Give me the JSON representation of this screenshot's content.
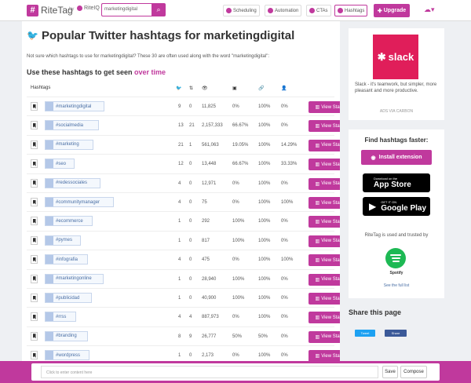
{
  "brand": {
    "logo_text": "RiteTag",
    "by": "by",
    "riteq": "RiteIQ",
    "accent": "#c0399d"
  },
  "search": {
    "value": "marketingdigital"
  },
  "nav": [
    {
      "label": "Scheduling",
      "active": false
    },
    {
      "label": "Automation",
      "active": false
    },
    {
      "label": "CTAs",
      "active": false
    },
    {
      "label": "Hashtags",
      "active": true
    }
  ],
  "upgrade_label": "Upgrade",
  "page": {
    "title": "Popular Twitter hashtags for marketingdigital",
    "description": "Not sure which hashtags to use for marketingdigital? These 30 are often used along with the word \"marketingdigital\":",
    "subtitle": "Use these hashtags to get seen ",
    "subtitle_accent": "over time"
  },
  "table": {
    "header_label": "Hashtags",
    "view_stats_label": "View Stats",
    "rows": [
      {
        "tag": "#marketingdigital",
        "tweets": "9",
        "retweets": "0",
        "exposure": "11,825",
        "images": "0%",
        "links": "100%",
        "mentions": "0%"
      },
      {
        "tag": "#socialmedia",
        "tweets": "13",
        "retweets": "21",
        "exposure": "2,157,333",
        "images": "66.67%",
        "links": "100%",
        "mentions": "0%"
      },
      {
        "tag": "#marketing",
        "tweets": "21",
        "retweets": "1",
        "exposure": "561,063",
        "images": "19.05%",
        "links": "100%",
        "mentions": "14.29%"
      },
      {
        "tag": "#seo",
        "tweets": "12",
        "retweets": "0",
        "exposure": "13,448",
        "images": "66.67%",
        "links": "100%",
        "mentions": "33.33%"
      },
      {
        "tag": "#redessociales",
        "tweets": "4",
        "retweets": "0",
        "exposure": "12,971",
        "images": "0%",
        "links": "100%",
        "mentions": "0%"
      },
      {
        "tag": "#communitymanager",
        "tweets": "4",
        "retweets": "0",
        "exposure": "75",
        "images": "0%",
        "links": "100%",
        "mentions": "100%"
      },
      {
        "tag": "#ecommerce",
        "tweets": "1",
        "retweets": "0",
        "exposure": "292",
        "images": "100%",
        "links": "100%",
        "mentions": "0%"
      },
      {
        "tag": "#pymes",
        "tweets": "1",
        "retweets": "0",
        "exposure": "817",
        "images": "100%",
        "links": "100%",
        "mentions": "0%"
      },
      {
        "tag": "#infografia",
        "tweets": "4",
        "retweets": "0",
        "exposure": "475",
        "images": "0%",
        "links": "100%",
        "mentions": "100%"
      },
      {
        "tag": "#marketingonline",
        "tweets": "1",
        "retweets": "0",
        "exposure": "28,940",
        "images": "100%",
        "links": "100%",
        "mentions": "0%"
      },
      {
        "tag": "#publicidad",
        "tweets": "1",
        "retweets": "0",
        "exposure": "40,900",
        "images": "100%",
        "links": "100%",
        "mentions": "0%"
      },
      {
        "tag": "#rrss",
        "tweets": "4",
        "retweets": "4",
        "exposure": "887,973",
        "images": "0%",
        "links": "100%",
        "mentions": "0%"
      },
      {
        "tag": "#branding",
        "tweets": "8",
        "retweets": "9",
        "exposure": "26,777",
        "images": "50%",
        "links": "50%",
        "mentions": "0%"
      },
      {
        "tag": "#wordpress",
        "tweets": "1",
        "retweets": "0",
        "exposure": "2,173",
        "images": "0%",
        "links": "100%",
        "mentions": "0%"
      }
    ]
  },
  "ad": {
    "logo_text": "slack",
    "text": "Slack - it's teamwork, but simpler, more pleasant and more productive.",
    "ads_by": "ADS VIA CARBON"
  },
  "sidebar": {
    "find_title": "Find hashtags faster:",
    "install_label": "Install extension",
    "appstore_small": "Download on the",
    "appstore_big": "App Store",
    "gplay_small": "GET IT ON",
    "gplay_big": "Google Play",
    "trusted": "RiteTag is used and trusted by",
    "spotify": "Spotify",
    "see_full": "See the full list"
  },
  "share": {
    "title": "Share this page",
    "tweet": "Tweet",
    "facebook": "Share"
  },
  "bottombar": {
    "placeholder": "Click to enter content here",
    "save": "Save",
    "compose": "Compose"
  }
}
